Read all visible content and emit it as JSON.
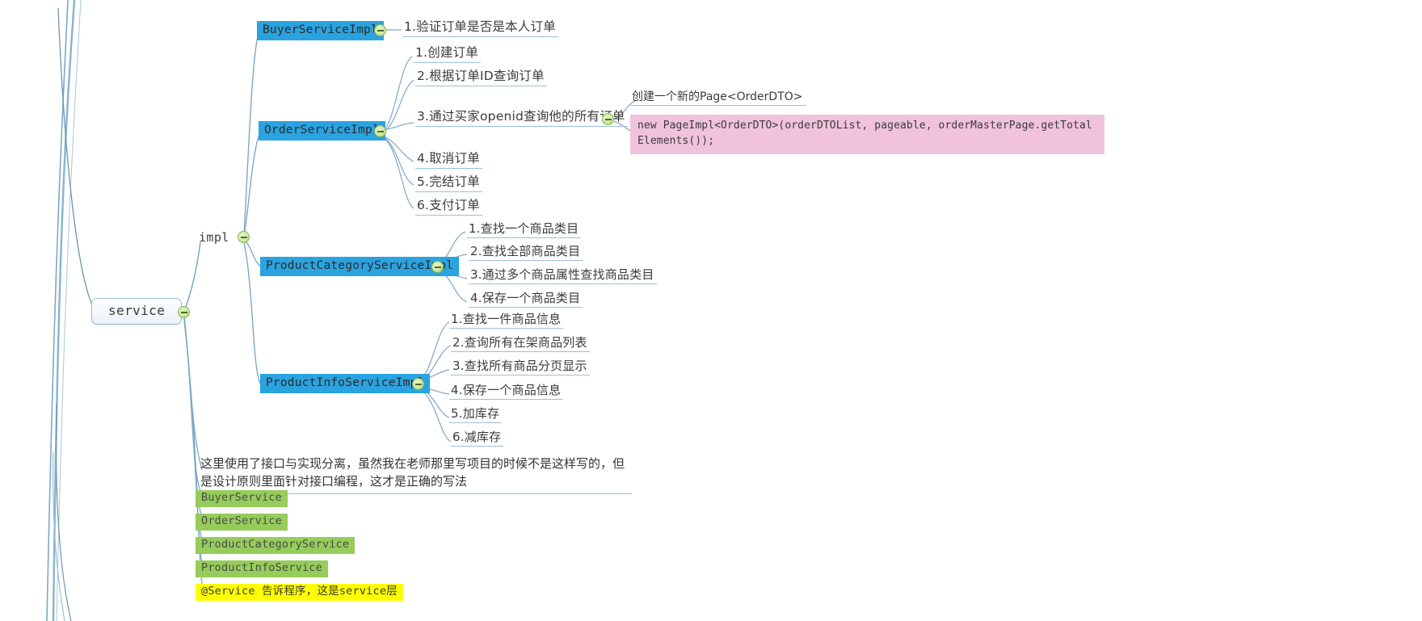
{
  "mindmap": {
    "root": {
      "label": "service"
    },
    "branch_label": "impl",
    "impl_classes": [
      {
        "name": "BuyerServiceImpl",
        "children": [
          "1.验证订单是否是本人订单"
        ]
      },
      {
        "name": "OrderServiceImpl",
        "children": [
          "1.创建订单",
          "2.根据订单ID查询订单",
          "3.通过买家openid查询他的所有订单",
          "4.取消订单",
          "5.完结订单",
          "6.支付订单"
        ]
      },
      {
        "name": "ProductCategoryServiceImpl",
        "children": [
          "1.查找一个商品类目",
          "2.查找全部商品类目",
          "3.通过多个商品属性查找商品类目",
          "4.保存一个商品类目"
        ]
      },
      {
        "name": "ProductInfoServiceImpl",
        "children": [
          "1.查找一件商品信息",
          "2.查询所有在架商品列表",
          "3.查找所有商品分页显示",
          "4.保存一个商品信息",
          "5.加库存",
          "6.减库存"
        ]
      }
    ],
    "code_note": {
      "title": "创建一个新的Page<OrderDTO>",
      "code": "new PageImpl<OrderDTO>(orderDTOList, pageable, orderMasterPage.getTotalElements());"
    },
    "design_note": "这里使用了接口与实现分离，虽然我在老师那里写项目的时候不是这样写的，但是设计原则里面针对接口编程，这才是正确的写法",
    "interfaces": [
      "BuyerService",
      "OrderService",
      "ProductCategoryService",
      "ProductInfoService"
    ],
    "annotation_note": "@Service 告诉程序，这是service层"
  },
  "colors": {
    "class_node_bg": "#2aa3e0",
    "interface_node_bg": "#96cc5a",
    "annotation_bg": "#ffff00",
    "code_note_bg": "#f0c2dc",
    "link": "#7fa8c4",
    "toggle": "#a9cf6f"
  }
}
